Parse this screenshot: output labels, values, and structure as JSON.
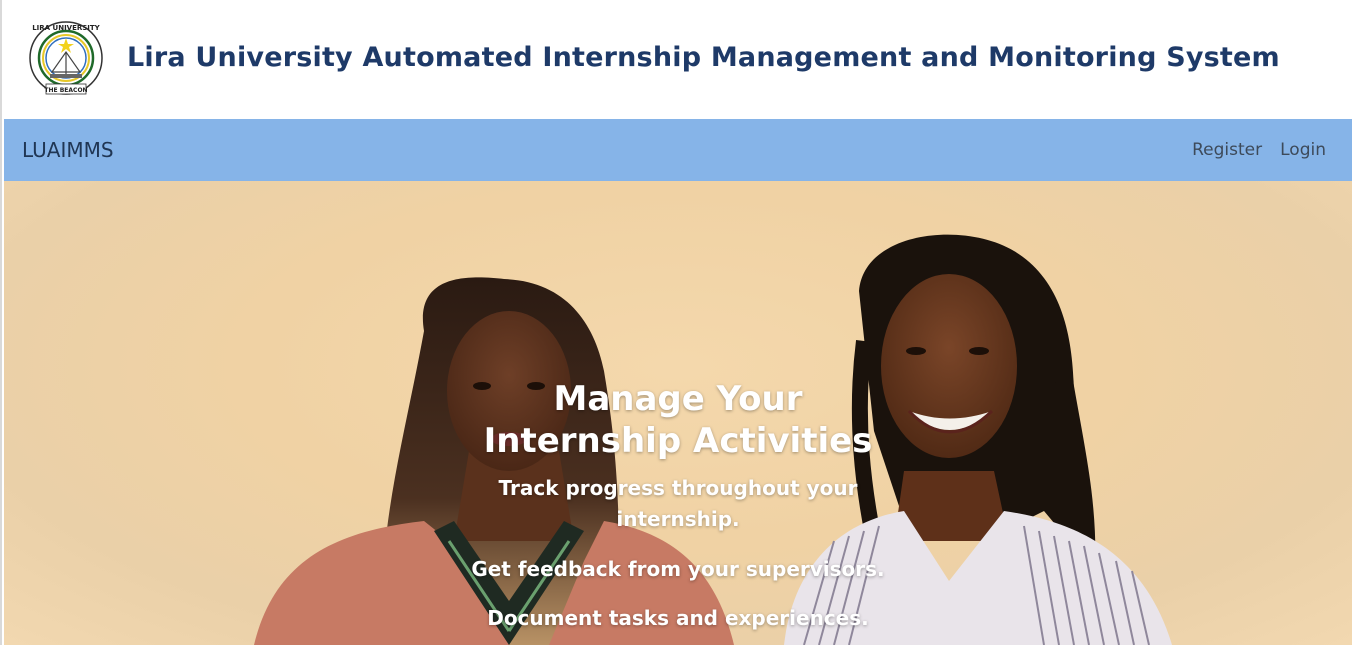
{
  "header": {
    "logo": {
      "text_top": "LIRA UNIVERSITY",
      "text_bottom": "THE BEACON"
    },
    "title": "Lira University Automated Internship Management and Monitoring System"
  },
  "navbar": {
    "brand": "LUAIMMS",
    "links": [
      {
        "label": "Register"
      },
      {
        "label": "Login"
      }
    ]
  },
  "hero": {
    "heading_line1": "Manage Your",
    "heading_line2": "Internship Activities",
    "paragraphs": [
      "Track progress throughout your internship.",
      "Get feedback from your supervisors.",
      "Document tasks and experiences."
    ]
  },
  "colors": {
    "title": "#1e3a68",
    "navbar_bg": "#86b4e8",
    "hero_bg": "#f0d2a4"
  }
}
